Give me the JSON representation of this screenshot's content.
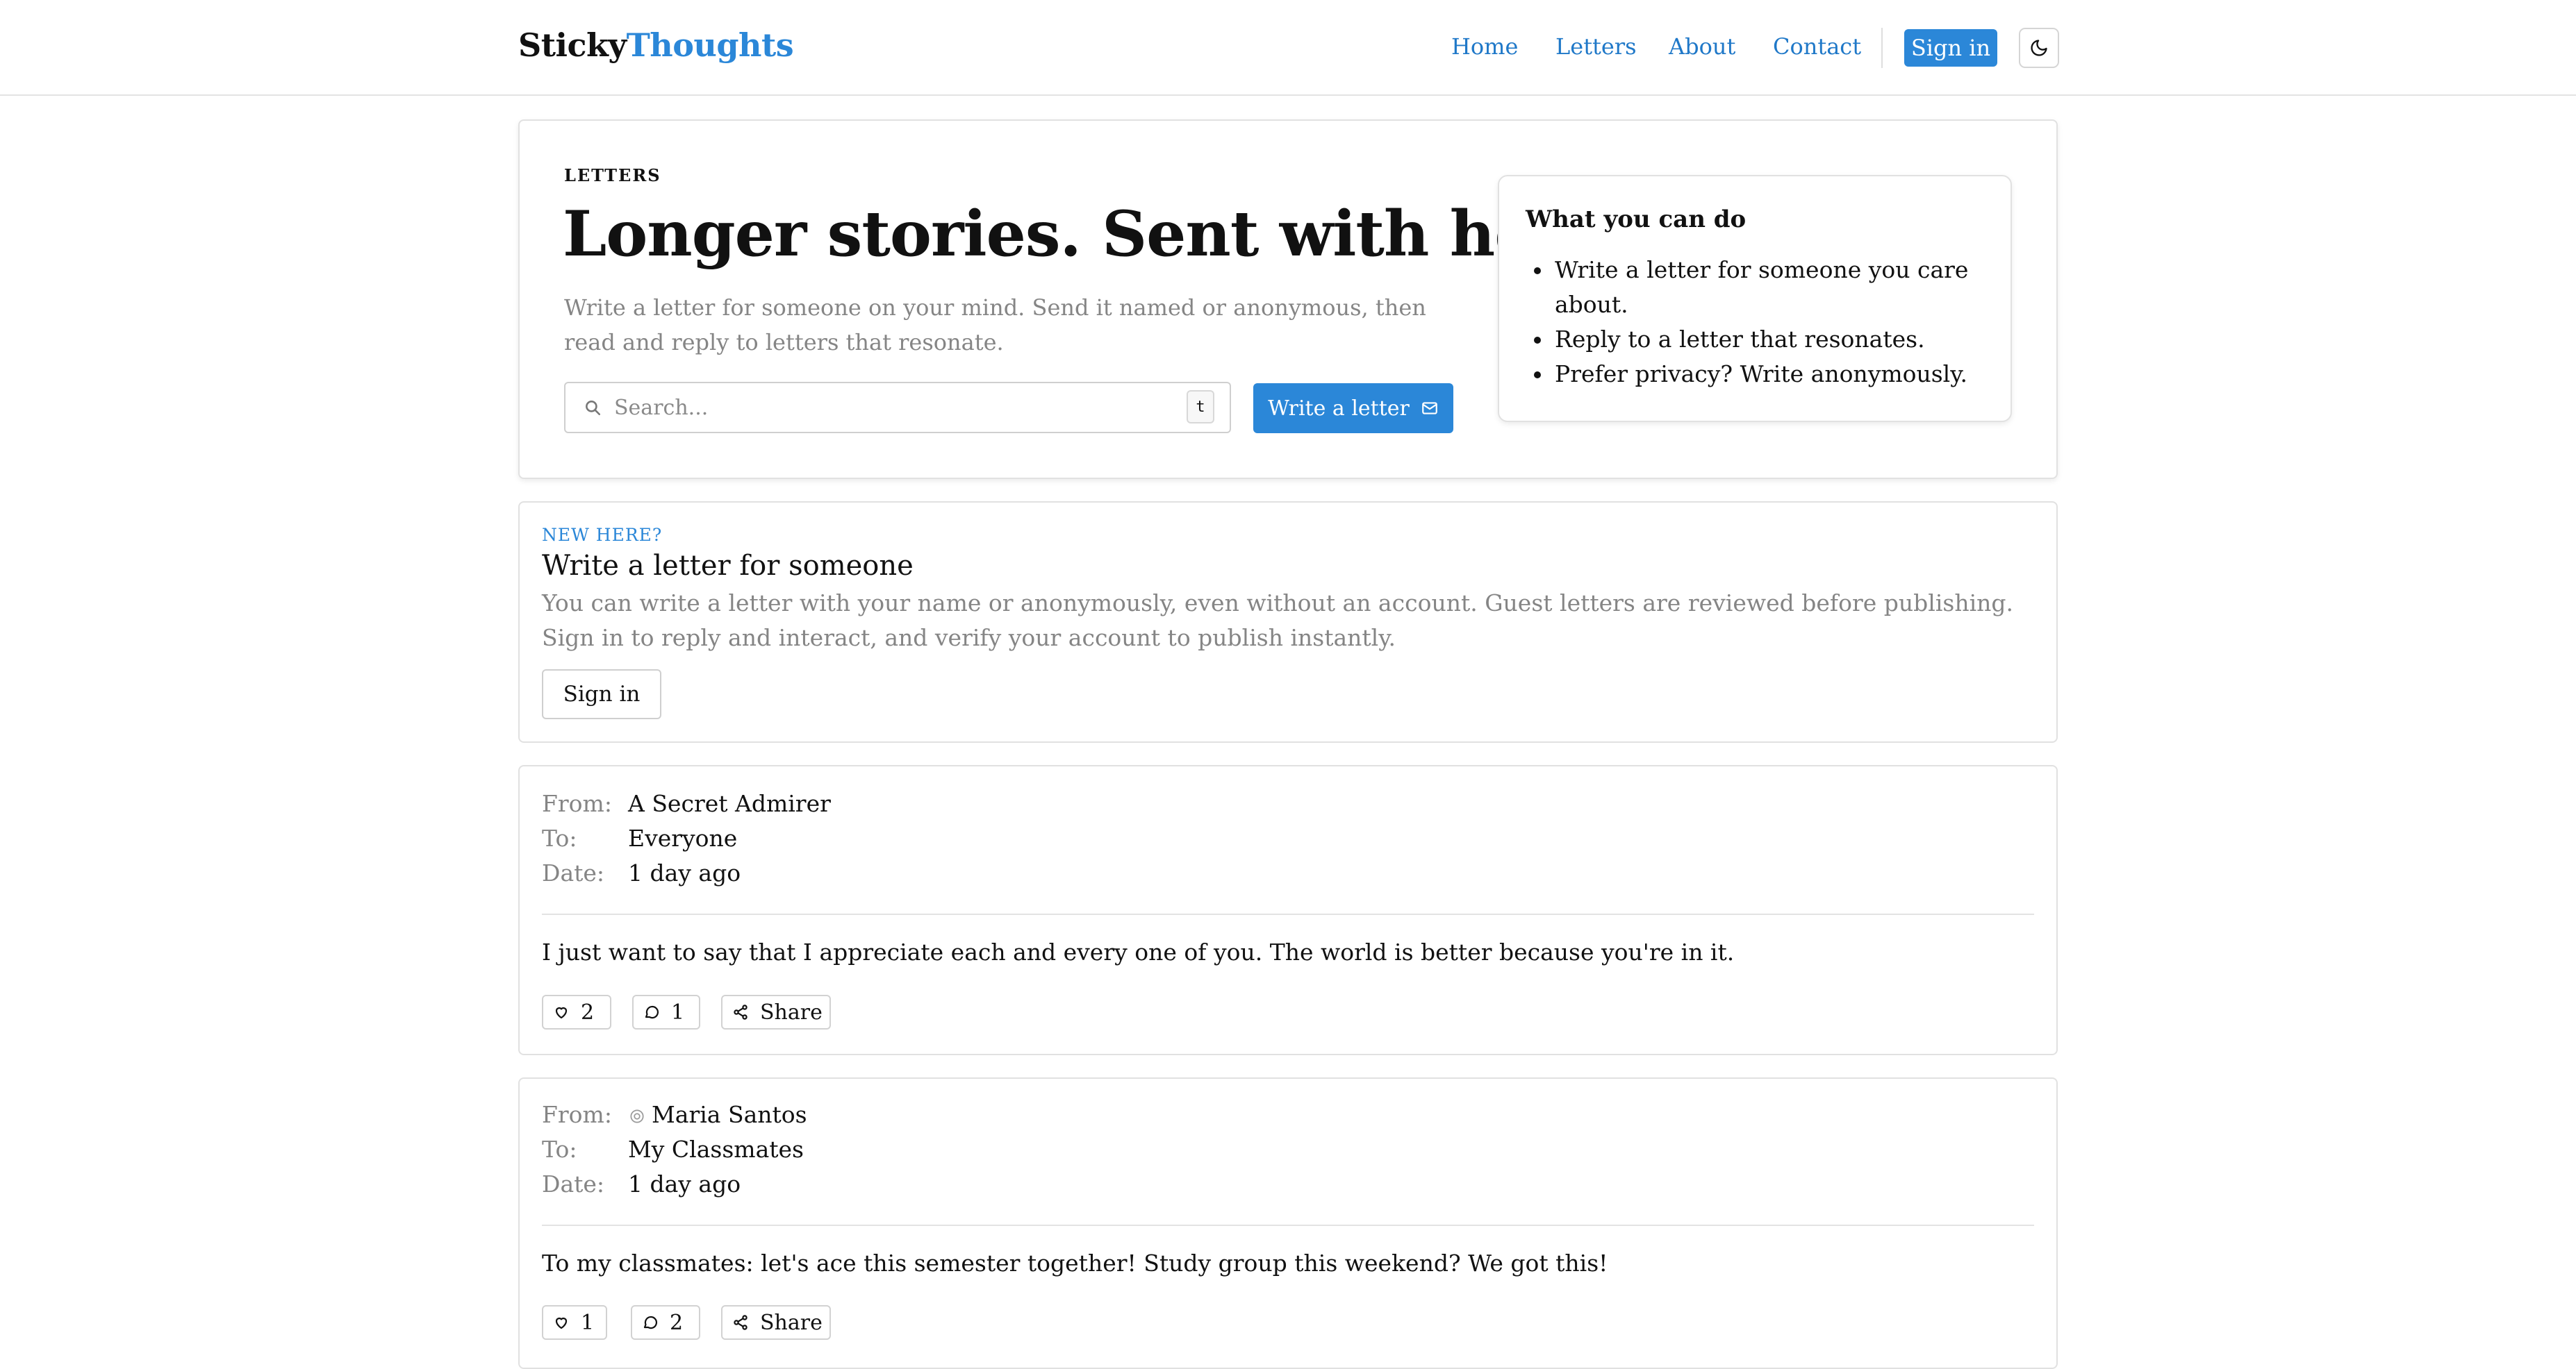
{
  "header": {
    "brand_part1": "Sticky",
    "brand_part2": "Thoughts",
    "nav": [
      "Home",
      "Letters",
      "About",
      "Contact"
    ],
    "signin_label": "Sign in",
    "theme_toggle_icon": "moon-icon"
  },
  "hero": {
    "eyebrow": "LETTERS",
    "title": "Longer stories. Sent with heart.",
    "subtitle": "Write a letter for someone on your mind. Send it named or anonymous, then read and reply to letters that resonate.",
    "search_placeholder": "Search...",
    "search_shortcut": "t",
    "write_button": "Write a letter"
  },
  "what_you_can_do": {
    "title": "What you can do",
    "items": [
      "Write a letter for someone you care about.",
      "Reply to a letter that resonates.",
      "Prefer privacy? Write anonymously."
    ]
  },
  "new_here": {
    "eyebrow": "NEW HERE?",
    "title": "Write a letter for someone",
    "body": "You can write a letter with your name or anonymously, even without an account. Guest letters are reviewed before publishing. Sign in to reply and interact, and verify your account to publish instantly.",
    "signin_button": "Sign in"
  },
  "labels": {
    "from": "From:",
    "to": "To:",
    "date": "Date:",
    "share": "Share"
  },
  "letters": [
    {
      "from": "A Secret Admirer",
      "to": "Everyone",
      "date": "1 day ago",
      "body": "I just want to say that I appreciate each and every one of you. The world is better because you're in it.",
      "likes": "2",
      "comments": "1"
    },
    {
      "from": "Maria Santos",
      "to": "My Classmates",
      "date": "1 day ago",
      "body": "To my classmates: let's ace this semester together! Study group this weekend? We got this!",
      "likes": "1",
      "comments": "2"
    }
  ],
  "colors": {
    "accent": "#2b87d8",
    "muted": "#858585",
    "border": "#e1e1e1"
  }
}
